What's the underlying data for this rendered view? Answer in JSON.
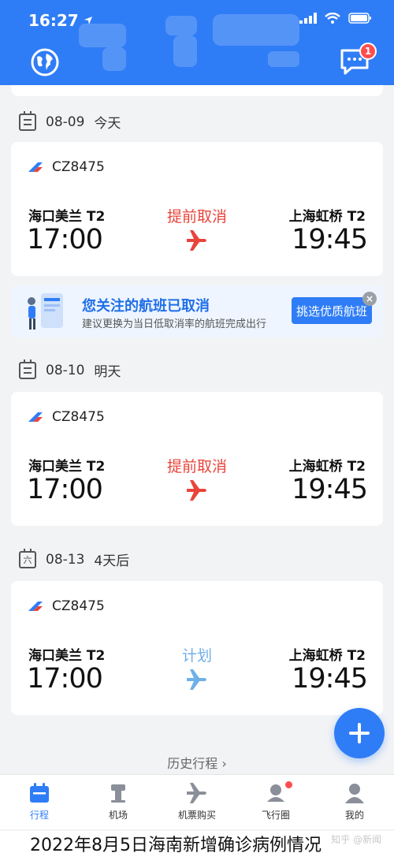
{
  "status_bar": {
    "time": "16:27"
  },
  "header": {
    "message_badge": "1"
  },
  "sections": [
    {
      "date": "08-09",
      "relative": "今天",
      "calendar_glyph": ""
    },
    {
      "date": "08-10",
      "relative": "明天",
      "calendar_glyph": ""
    },
    {
      "date": "08-13",
      "relative": "4天后",
      "calendar_glyph": "六"
    }
  ],
  "flights": [
    {
      "flight_no": "CZ8475",
      "dep_airport": "海口美兰 T2",
      "dep_time": "17:00",
      "arr_airport": "上海虹桥 T2",
      "arr_time": "19:45",
      "status": "提前取消",
      "status_color": "#e8443a"
    },
    {
      "flight_no": "CZ8475",
      "dep_airport": "海口美兰 T2",
      "dep_time": "17:00",
      "arr_airport": "上海虹桥 T2",
      "arr_time": "19:45",
      "status": "提前取消",
      "status_color": "#e8443a"
    },
    {
      "flight_no": "CZ8475",
      "dep_airport": "海口美兰 T2",
      "dep_time": "17:00",
      "arr_airport": "上海虹桥 T2",
      "arr_time": "19:45",
      "status": "计划",
      "status_color": "#6fb0e8"
    }
  ],
  "promo": {
    "title": "您关注的航班已取消",
    "subtitle": "建议更换为当日低取消率的航班完成出行",
    "button": "挑选优质航班"
  },
  "history_link": "历史行程 ›",
  "tabbar": [
    {
      "label": "行程",
      "icon": "calendar-icon"
    },
    {
      "label": "机场",
      "icon": "tower-icon"
    },
    {
      "label": "机票购买",
      "icon": "plane-icon"
    },
    {
      "label": "飞行圈",
      "icon": "community-icon"
    },
    {
      "label": "我的",
      "icon": "user-icon"
    }
  ],
  "caption": "2022年8月5日海南新增确诊病例情况",
  "watermark": "知乎 @新闻",
  "colors": {
    "primary": "#2f7df6",
    "cancel": "#e8443a",
    "planned": "#6fb0e8"
  }
}
